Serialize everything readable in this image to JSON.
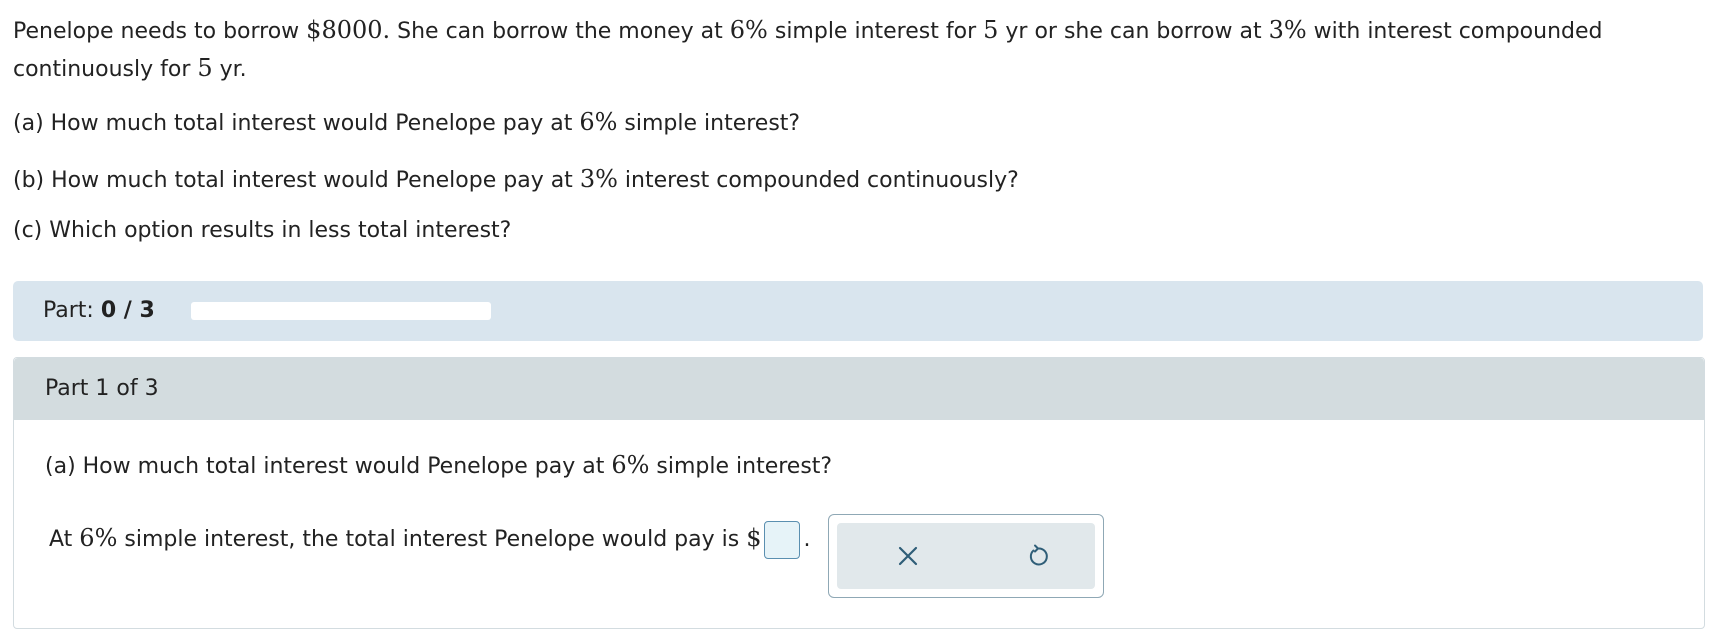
{
  "problem": {
    "p1": "Penelope needs to borrow ",
    "amount": "$8000.",
    "p2": " She can borrow the money at ",
    "rate1": "6%",
    "p3": " simple interest for ",
    "years1": "5",
    "p4": " yr or she can borrow at ",
    "rate2": "3%",
    "p5": " with interest compounded continuously for ",
    "years2": "5",
    "p6": " yr."
  },
  "questions": {
    "a_pre": "(a) How much total interest would Penelope pay at ",
    "a_rate": "6%",
    "a_post": " simple interest?",
    "b_pre": "(b) How much total interest would Penelope pay at ",
    "b_rate": "3%",
    "b_post": " interest compounded continuously?",
    "c": "(c) Which option results in less total interest?"
  },
  "progress": {
    "label": "Part: ",
    "value": "0 / 3",
    "fraction": 0
  },
  "part": {
    "header": "Part 1 of 3",
    "q_pre": "(a) How much total interest would Penelope pay at ",
    "q_rate": "6%",
    "q_post": " simple interest?",
    "answer_pre": "At ",
    "answer_rate": "6%",
    "answer_post": " simple interest, the total interest Penelope would pay is ",
    "currency": "$",
    "answer_value": "",
    "period": "."
  },
  "tools": {
    "clear_icon": "close-icon",
    "undo_icon": "undo-icon"
  }
}
